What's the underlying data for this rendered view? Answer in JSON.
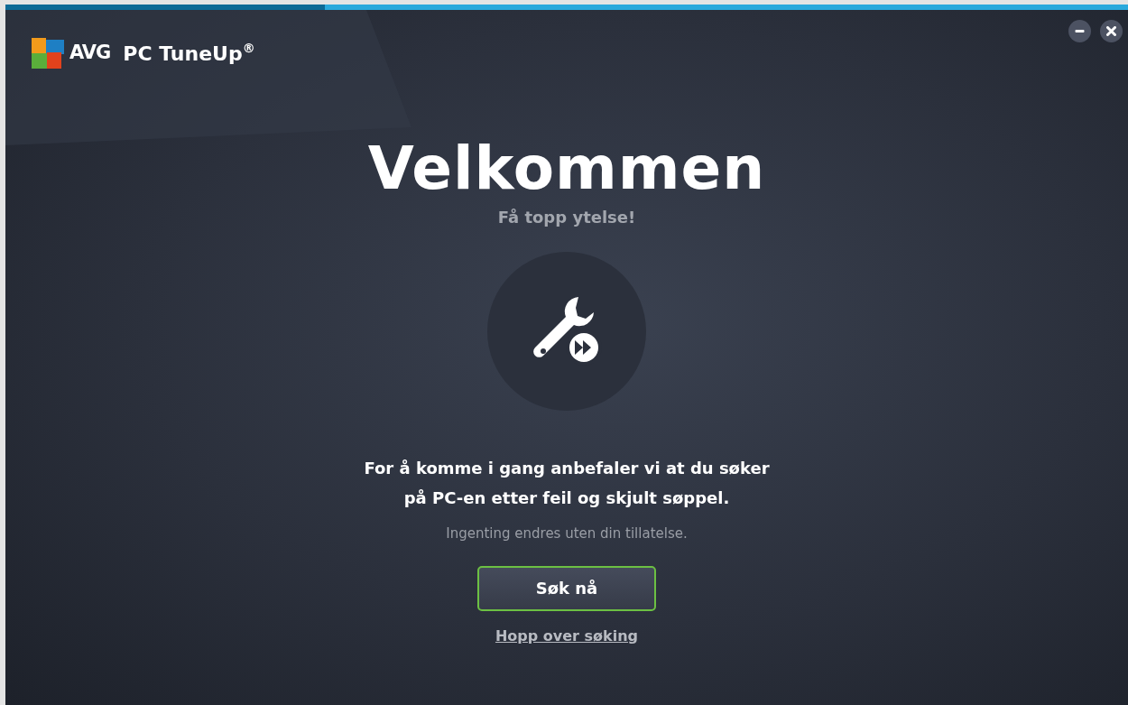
{
  "app": {
    "brand": "AVG",
    "product": "PC TuneUp$^{®}$"
  },
  "window_controls": [
    {
      "kind": "minimize"
    },
    {
      "kind": "close"
    }
  ],
  "welcome": {
    "heading": "Velkommen",
    "subtitle": "Få topp ytelse!"
  },
  "message": [
    "For å komme i gang anbefaler vi at du søker",
    "på PC-en etter feil og skjult søppel."
  ],
  "note": "Ingenting endres uten din tillatelse.",
  "primary_button": "Søk nå",
  "skip_link": "Hopp over søking"
}
